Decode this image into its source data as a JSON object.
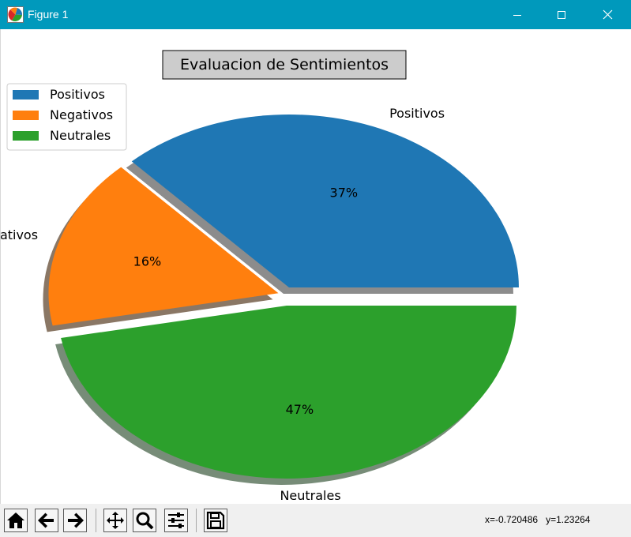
{
  "window": {
    "title": "Figure 1",
    "icons": {
      "app": "matplotlib-figure-icon",
      "minimize": "minimize-icon",
      "maximize": "maximize-icon",
      "close": "close-icon"
    }
  },
  "chart_data": {
    "type": "pie",
    "title": "Evaluacion de Sentimientos",
    "labels": [
      "Positivos",
      "Negativos",
      "Neutrales"
    ],
    "values": [
      37,
      16,
      47
    ],
    "autopct_labels": [
      "37%",
      "16%",
      "47%"
    ],
    "colors": [
      "#1f77b4",
      "#ff7f0e",
      "#2ca02c"
    ],
    "exploded": true,
    "shadow": true,
    "legend": {
      "entries": [
        "Positivos",
        "Negativos",
        "Neutrales"
      ],
      "placement": "top-left"
    }
  },
  "toolbar": {
    "buttons": [
      "home-icon",
      "back-icon",
      "forward-icon",
      "pan-icon",
      "zoom-icon",
      "configure-subplots-icon",
      "save-icon"
    ],
    "coords_x": "x=-0.720486",
    "coords_y": "y=1.23264"
  }
}
